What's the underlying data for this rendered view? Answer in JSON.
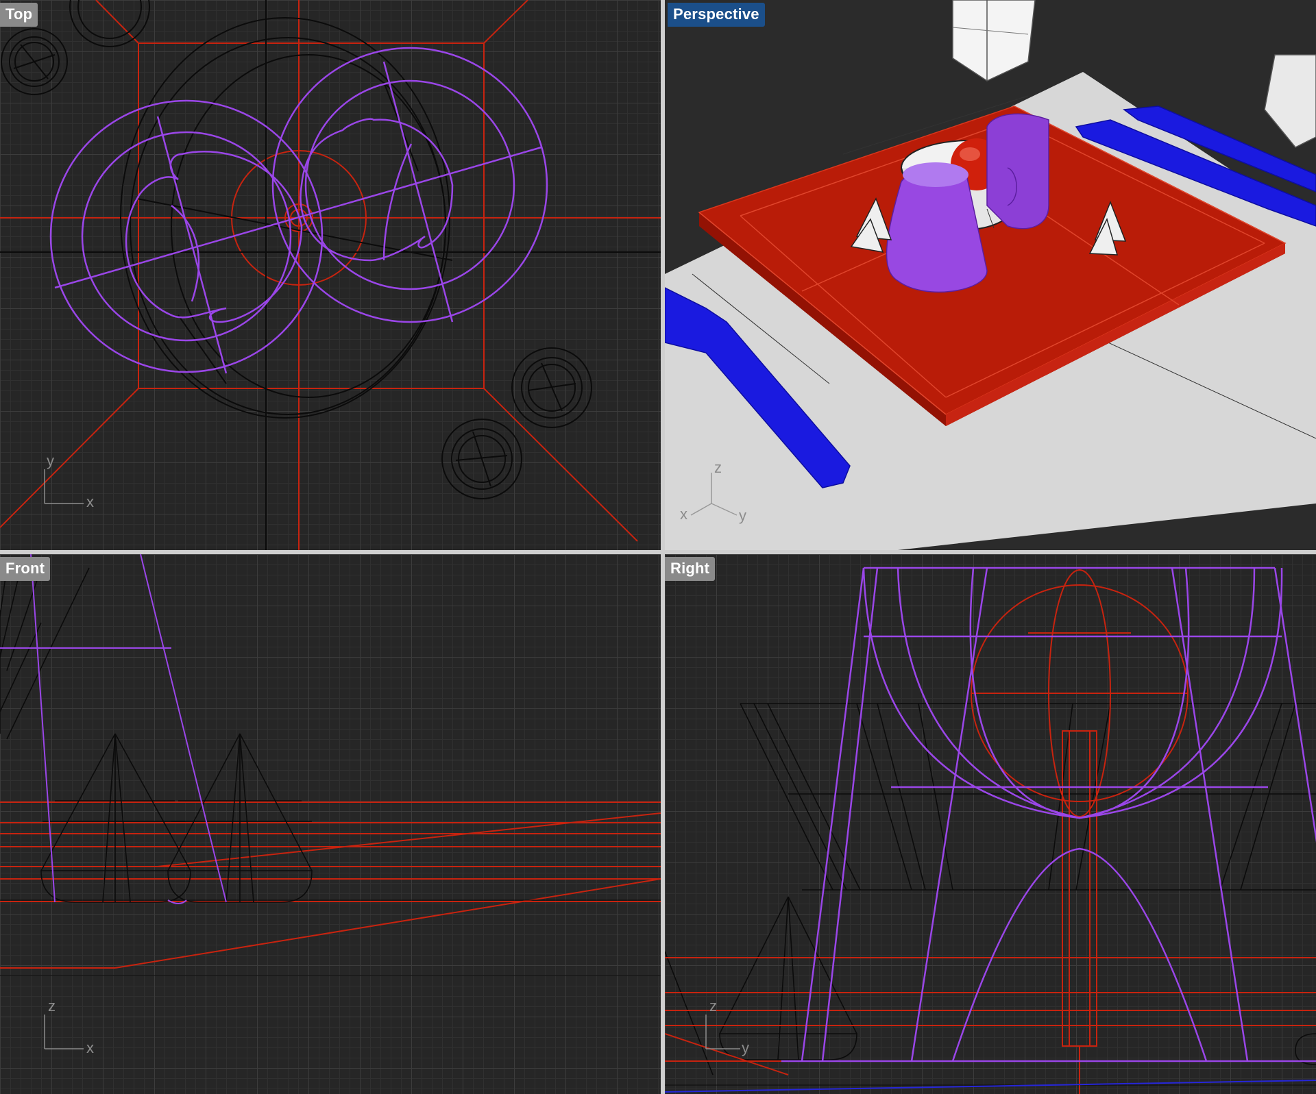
{
  "viewports": {
    "top": {
      "label": "Top",
      "axes": [
        "y",
        "x"
      ]
    },
    "persp": {
      "label": "Perspective",
      "axes": [
        "z",
        "x",
        "y"
      ]
    },
    "front": {
      "label": "Front",
      "axes": [
        "z",
        "x"
      ]
    },
    "right": {
      "label": "Right",
      "axes": [
        "z",
        "y"
      ]
    }
  },
  "colors": {
    "background": "#262626",
    "grid_major": "#3c3c3c",
    "grid_minor": "#303030",
    "wire_black": "#0b0b0b",
    "wire_red": "#c8230f",
    "wire_purple": "#9a46e8",
    "perspective_label_bg": "#1b4f8a",
    "shaded_red": "#b31b06",
    "shaded_blue": "#1818d8",
    "shaded_purple": "#8c3fd6",
    "ground_plane": "#d7d7d7"
  }
}
